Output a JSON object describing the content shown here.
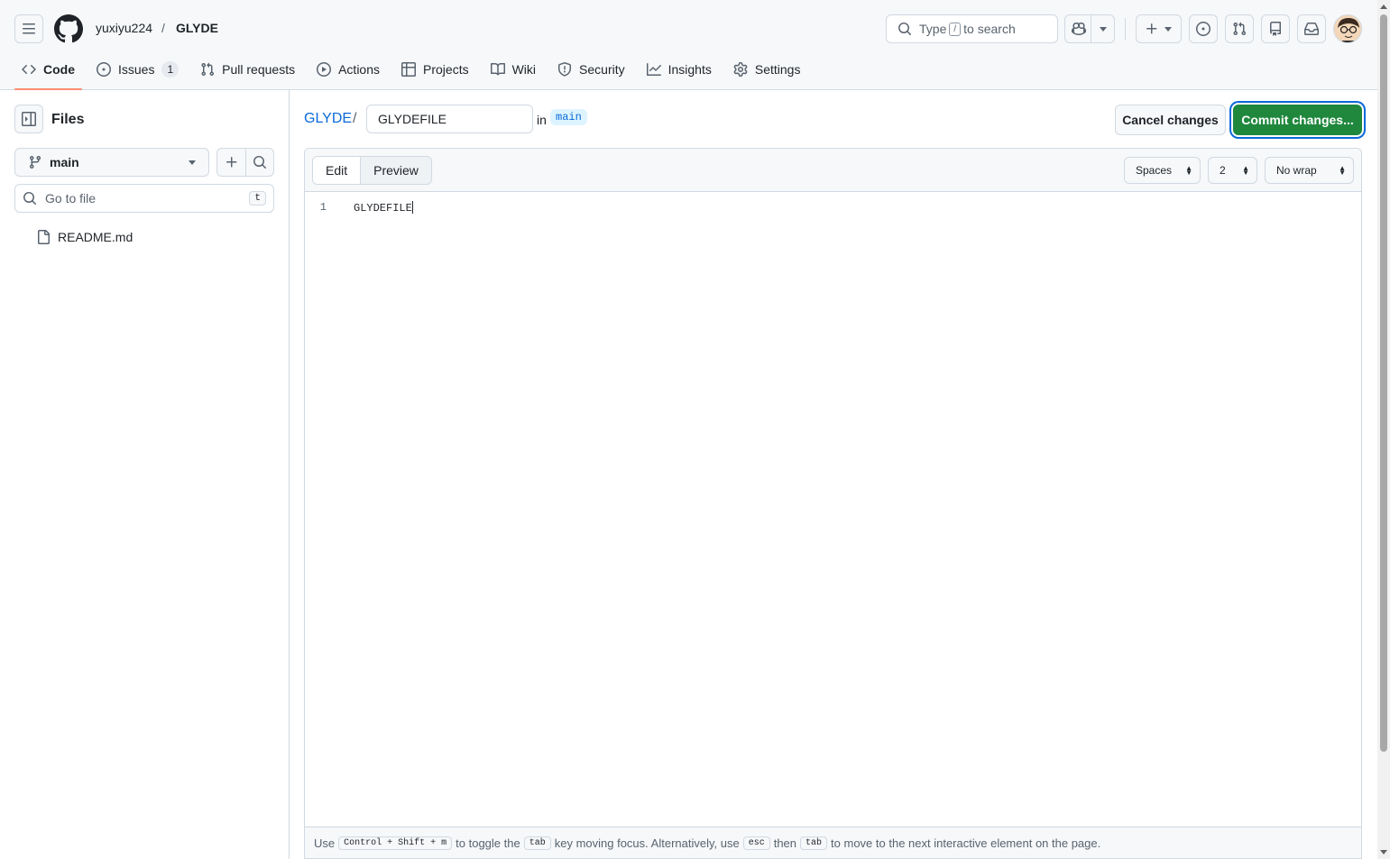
{
  "header": {
    "owner": "yuxiyu224",
    "separator": "/",
    "repo": "GLYDE",
    "search": {
      "prefix": "Type",
      "key": "/",
      "suffix": "to search"
    }
  },
  "tabs": [
    {
      "label": "Code",
      "icon": "code-icon",
      "active": true
    },
    {
      "label": "Issues",
      "icon": "issue-icon",
      "count": "1"
    },
    {
      "label": "Pull requests",
      "icon": "pull-request-icon"
    },
    {
      "label": "Actions",
      "icon": "play-icon"
    },
    {
      "label": "Projects",
      "icon": "table-icon"
    },
    {
      "label": "Wiki",
      "icon": "book-icon"
    },
    {
      "label": "Security",
      "icon": "shield-icon"
    },
    {
      "label": "Insights",
      "icon": "graph-icon"
    },
    {
      "label": "Settings",
      "icon": "gear-icon"
    }
  ],
  "sidebar": {
    "title": "Files",
    "branch": "main",
    "goto_placeholder": "Go to file",
    "goto_key": "t",
    "files": [
      {
        "name": "README.md"
      }
    ]
  },
  "editor": {
    "repo_crumb": "GLYDE",
    "separator": "/",
    "filename": "GLYDEFILE",
    "in_label": "in",
    "branch": "main",
    "cancel_label": "Cancel changes",
    "commit_label": "Commit changes...",
    "edit_tab": "Edit",
    "preview_tab": "Preview",
    "indent_mode": "Spaces",
    "indent_size": "2",
    "wrap_mode": "No wrap",
    "lines": [
      {
        "number": "1",
        "text": "GLYDEFILE"
      }
    ],
    "hint": {
      "use": "Use",
      "shortcut": "Control + Shift + m",
      "toggle_the": "to toggle the",
      "tab_key": "tab",
      "key_moving": "key moving focus. Alternatively, use",
      "esc_key": "esc",
      "then": "then",
      "tab_key2": "tab",
      "rest": "to move to the next interactive element on the page."
    }
  },
  "colors": {
    "accent": "#0969da",
    "commit_green": "#1f883d",
    "active_tab_underline": "#fd8c73"
  }
}
